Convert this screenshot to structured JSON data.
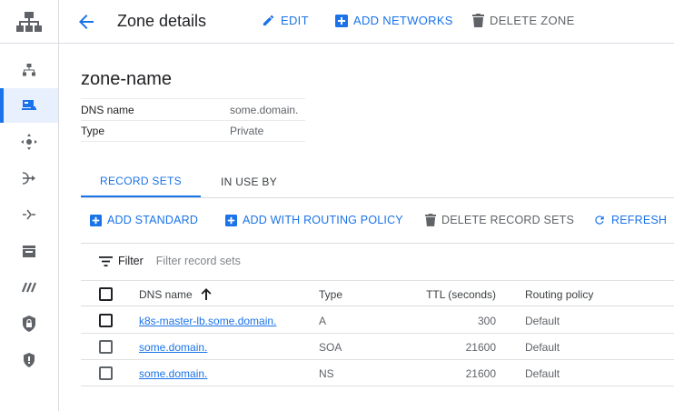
{
  "header": {
    "title": "Zone details",
    "edit_label": "EDIT",
    "add_networks_label": "ADD NETWORKS",
    "delete_zone_label": "DELETE ZONE"
  },
  "nav": {
    "items": [
      {
        "icon": "network-topology-icon"
      },
      {
        "icon": "cloud-dns-icon",
        "active": true
      },
      {
        "icon": "load-balancing-icon"
      },
      {
        "icon": "cloud-nat-icon"
      },
      {
        "icon": "traffic-director-icon"
      },
      {
        "icon": "cdn-icon"
      },
      {
        "icon": "service-directory-icon"
      },
      {
        "icon": "private-service-lock-icon"
      },
      {
        "icon": "security-shield-icon"
      }
    ]
  },
  "zone": {
    "name": "zone-name",
    "details": [
      {
        "key": "DNS name",
        "value": "some.domain."
      },
      {
        "key": "Type",
        "value": "Private"
      }
    ]
  },
  "tabs": [
    "RECORD SETS",
    "IN USE BY"
  ],
  "toolbar": {
    "add_standard": "ADD STANDARD",
    "add_routing": "ADD WITH ROUTING POLICY",
    "delete_record_sets": "DELETE RECORD SETS",
    "refresh": "REFRESH"
  },
  "filter": {
    "label": "Filter",
    "placeholder": "Filter record sets"
  },
  "table": {
    "columns": [
      "DNS name",
      "Type",
      "TTL (seconds)",
      "Routing policy"
    ],
    "sort": "ascending",
    "rows": [
      {
        "dns_name": "k8s-master-lb.some.domain.",
        "type": "A",
        "ttl": "300",
        "policy": "Default"
      },
      {
        "dns_name": "some.domain.",
        "type": "SOA",
        "ttl": "21600",
        "policy": "Default"
      },
      {
        "dns_name": "some.domain.",
        "type": "NS",
        "ttl": "21600",
        "policy": "Default"
      }
    ]
  },
  "colors": {
    "accent": "#1a73e8",
    "text": "#202124",
    "muted": "#5f6368",
    "nav_active_bg": "#e8f0fe"
  }
}
